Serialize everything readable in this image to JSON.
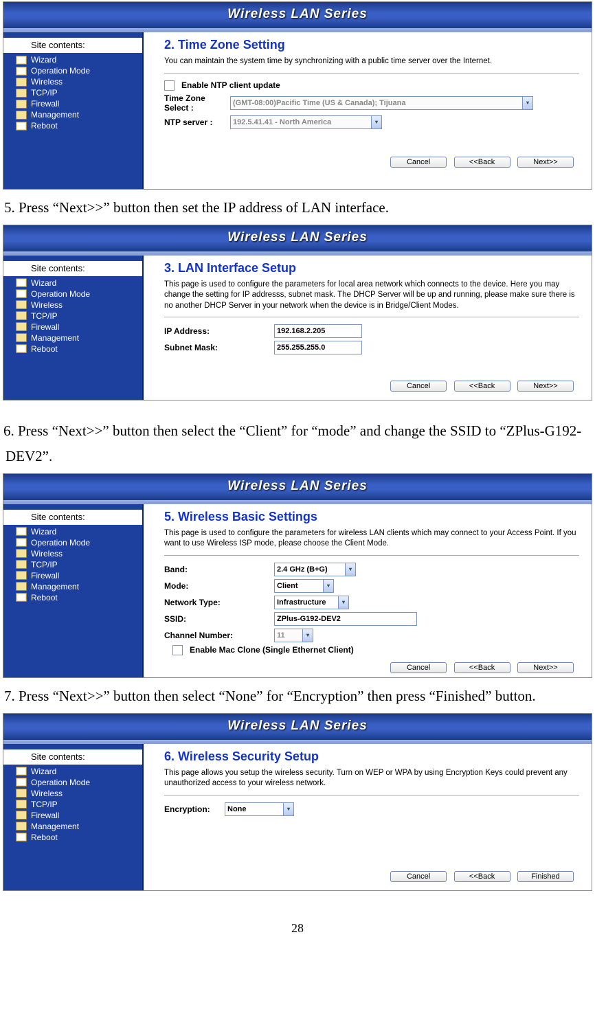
{
  "bannerTitle": "Wireless LAN Series",
  "siteContentsLabel": "Site contents:",
  "tree": {
    "wizard": "Wizard",
    "opmode": "Operation Mode",
    "wireless": "Wireless",
    "tcpip": "TCP/IP",
    "firewall": "Firewall",
    "management": "Management",
    "reboot": "Reboot"
  },
  "buttons": {
    "cancel": "Cancel",
    "back": "<<Back",
    "next": "Next>>",
    "finished": "Finished"
  },
  "shot2": {
    "title": "2. Time Zone Setting",
    "desc": "You can maintain the system time by synchronizing with a public time server over the Internet.",
    "ntpEnable": "Enable NTP client update",
    "tzLabel": "Time Zone Select :",
    "tzValue": "(GMT-08:00)Pacific Time (US & Canada); Tijuana",
    "ntpLabel": "NTP server :",
    "ntpValue": "192.5.41.41 - North America"
  },
  "instr5": "5. Press “Next>>” button then set the IP address of LAN interface.",
  "shot3": {
    "title": "3. LAN Interface Setup",
    "desc": "This page is used to configure the parameters for local area network which connects to the device. Here you may change the setting for IP addresss, subnet mask. The DHCP Server will be up and running, please make sure there is no another DHCP Server in your network when the device is in Bridge/Client Modes.",
    "ipLabel": "IP Address:",
    "ipValue": "192.168.2.205",
    "maskLabel": "Subnet Mask:",
    "maskValue": "255.255.255.0"
  },
  "instr6": "6. Press “Next>>” button then select the “Client” for “mode” and change the SSID to “ZPlus-G192-DEV2”.",
  "shot5": {
    "title": "5. Wireless Basic Settings",
    "desc": "This page is used to configure the parameters for wireless LAN clients which may connect to your Access Point. If you want to use Wireless ISP mode, please choose the Client Mode.",
    "bandLabel": "Band:",
    "bandValue": "2.4 GHz (B+G)",
    "modeLabel": "Mode:",
    "modeValue": "Client",
    "netLabel": "Network Type:",
    "netValue": "Infrastructure",
    "ssidLabel": "SSID:",
    "ssidValue": "ZPlus-G192-DEV2",
    "chLabel": "Channel Number:",
    "chValue": "11",
    "macClone": "Enable Mac Clone (Single Ethernet Client)"
  },
  "instr7": "7. Press “Next>>” button then select “None” for “Encryption” then press “Finished” button.",
  "shot6": {
    "title": "6. Wireless Security Setup",
    "desc": "This page allows you setup the wireless security. Turn on WEP or WPA by using Encryption Keys could prevent any unauthorized access to your wireless network.",
    "encLabel": "Encryption:",
    "encValue": "None"
  },
  "pageNumber": "28"
}
